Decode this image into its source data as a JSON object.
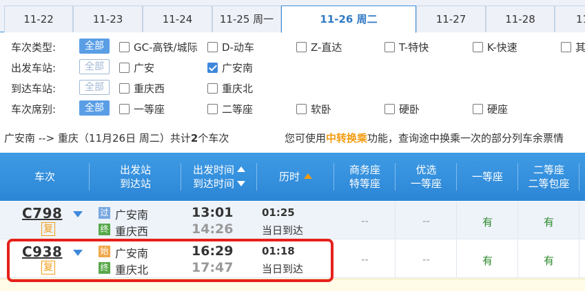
{
  "date_tabs": [
    {
      "label": "11-22",
      "active": false
    },
    {
      "label": "11-23",
      "active": false
    },
    {
      "label": "11-24",
      "active": false
    },
    {
      "label": "11-25 周一",
      "active": false
    },
    {
      "label": "11-26 周二",
      "active": true
    },
    {
      "label": "11-27",
      "active": false
    },
    {
      "label": "11-28",
      "active": false
    },
    {
      "label": "11",
      "active": false
    }
  ],
  "filters": {
    "all_label": "全部",
    "train_type": {
      "label": "车次类型:",
      "options": [
        "GC-高铁/城际",
        "D-动车",
        "Z-直达",
        "T-特快",
        "K-快速",
        "其"
      ]
    },
    "departure": {
      "label": "出发车站:",
      "options": [
        "广安",
        "广安南"
      ],
      "checked": "广安南"
    },
    "arrival": {
      "label": "到达车站:",
      "options": [
        "重庆西",
        "重庆北"
      ]
    },
    "seat_class": {
      "label": "车次席别:",
      "options": [
        "一等座",
        "二等座",
        "软卧",
        "硬卧",
        "硬座"
      ]
    }
  },
  "summary": {
    "route": "广安南 --> 重庆（11月26日  周二）共计",
    "count": "2",
    "suffix": "个车次",
    "tip_pre": "您可使用",
    "tip_link": "中转换乘",
    "tip_post": "功能，查询途中换乘一次的部分列车余票情"
  },
  "table": {
    "headers": {
      "train": "车次",
      "stations_1": "出发站",
      "stations_2": "到达站",
      "time_1": "出发时间",
      "time_2": "到达时间",
      "duration": "历时",
      "business_1": "商务座",
      "business_2": "特等座",
      "premium_1": "优选",
      "premium_2": "一等座",
      "first": "一等座",
      "second_1": "二等座",
      "second_2": "二等包座"
    },
    "rows": [
      {
        "train_no": "C798",
        "fu": "复",
        "from_badge": "过",
        "from": "广安南",
        "to_badge": "终",
        "to": "重庆西",
        "depart": "13:01",
        "arrive": "14:26",
        "duration": "01:25",
        "arrive_day": "当日到达",
        "business": "--",
        "premium": "--",
        "first": "有",
        "second": "有"
      },
      {
        "train_no": "C938",
        "fu": "复",
        "from_badge": "始",
        "from": "广安南",
        "to_badge": "终",
        "to": "重庆北",
        "depart": "16:29",
        "arrive": "17:47",
        "duration": "01:18",
        "arrive_day": "当日到达",
        "business": "--",
        "premium": "--",
        "first": "有",
        "second": "有"
      }
    ]
  },
  "colors": {
    "accent": "#3c8fd6",
    "highlight_box": "#e5201b",
    "available": "#2a8a2a"
  }
}
